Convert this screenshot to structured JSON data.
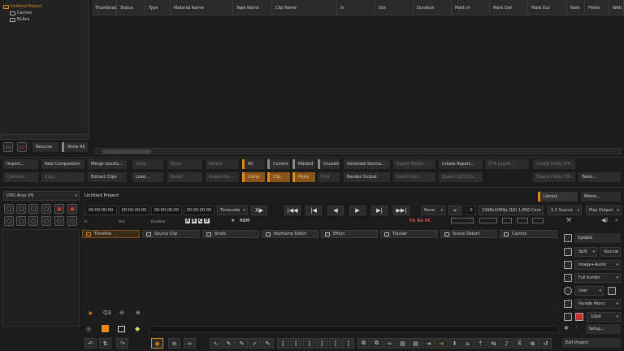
{
  "tree": {
    "items": [
      {
        "label": "Untitled Project",
        "active": true
      },
      {
        "label": "Caches",
        "active": false
      },
      {
        "label": "BLAce",
        "active": false
      }
    ],
    "recurse_label": "Recurse",
    "show_all_label": "Show All"
  },
  "grid": {
    "columns": [
      "Thumbnail",
      "Status",
      "Type",
      "Material Name",
      "Tape Name",
      "Clip Name",
      "In",
      "Out",
      "Duration",
      "Mark In",
      "Mark Out",
      "Mark Dur",
      "Rate",
      "Fields",
      "Web"
    ]
  },
  "actions": {
    "row1": [
      "Import...",
      "New Composition",
      "Merge results...",
      "Save...",
      "Store",
      "Delete",
      "All",
      "Current",
      "Marked",
      "Unused",
      "Generate Source...",
      "Export Media...",
      "Create Report...",
      "VTR Layoff...",
      "Config Dolby Clif..."
    ],
    "row2": [
      "Conform...",
      "Copy",
      "Extract Clips",
      "Load...",
      "Recall",
      "Properties...",
      "Comp",
      "Clip",
      "Proxy",
      "Find",
      "Render Output",
      "Export List...",
      "Export LUT/CDL...",
      "Export Dolby Clif...",
      "Tasks..."
    ]
  },
  "left_panel": {
    "alias_select": "DVD Alias (H)"
  },
  "project_title": "Untitled Project",
  "library_label": "Library",
  "memo_label": "Memo...",
  "transport": {
    "in_tc": "00:00:00:00",
    "out_tc": "00:00:00:00",
    "dur_tc": "00:00:00:00",
    "pos_tc": "00:00:00:00",
    "timecode_select": "Timecode",
    "field_labels": [
      "In",
      "Out",
      "Duration"
    ],
    "abcd": [
      "A",
      "B",
      "C",
      "D"
    ],
    "rem_label": "REM",
    "none_select": "None",
    "frame_value": "0",
    "format_select": "1998x1080p (16) 1.850 Cen",
    "source_select": "1:1 Source",
    "play_select": "Play Output",
    "fg_bg_label": "FG BG PC"
  },
  "tabs": [
    "Timeline",
    "Source Clip",
    "Shots",
    "Keyframe Editor",
    "Effect",
    "Tracker",
    "Scene Detect",
    "Caches"
  ],
  "right_panel": {
    "update_label": "Update",
    "split_select": "Split",
    "source_select": "Source",
    "image_audio_select": "Image+Audio",
    "border_select": "Full border",
    "user_select": "User",
    "parade_select": "Parade Mono",
    "bit_select": "10bit",
    "setup_label": "Setup...",
    "exit_label": "Exit Project"
  },
  "colors": {
    "accent": "#e08a1e",
    "bg": "#1b1b1b",
    "panel": "#2c2c2c"
  }
}
